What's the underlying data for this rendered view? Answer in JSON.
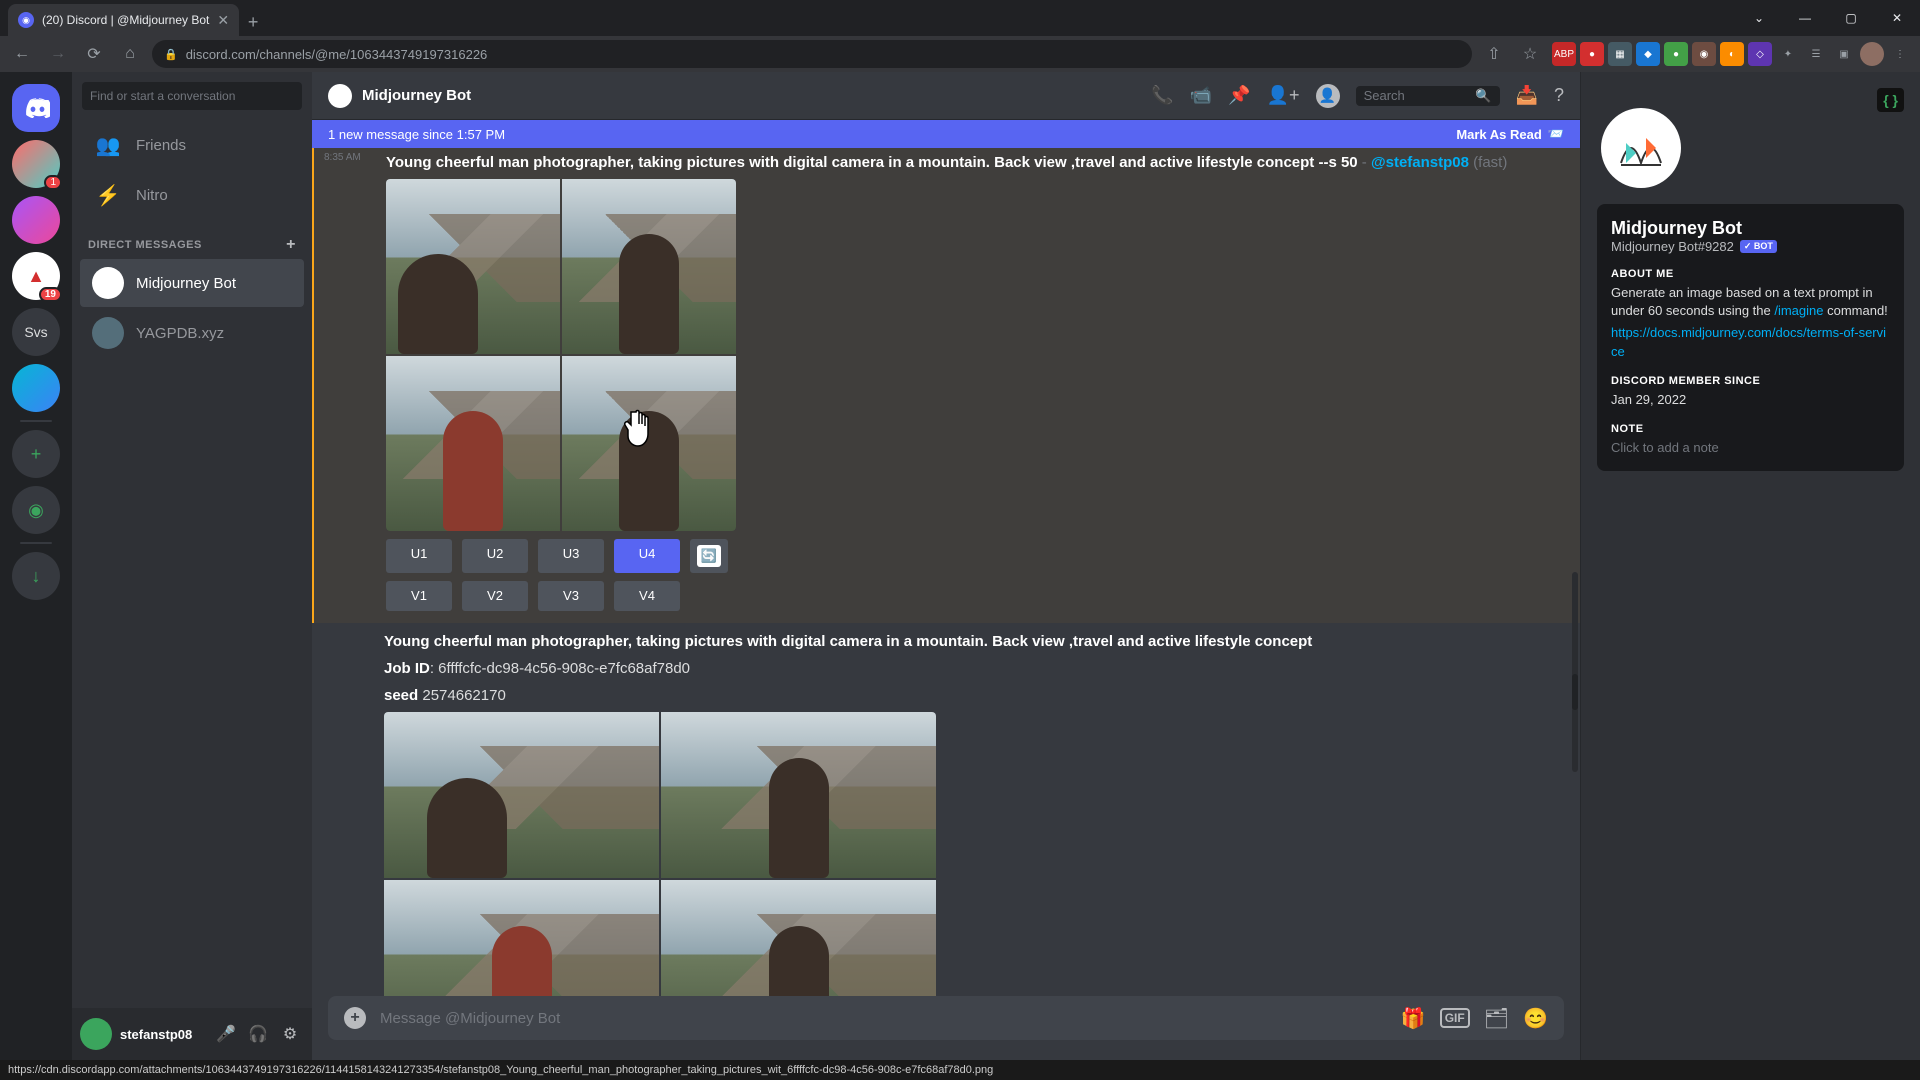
{
  "browser": {
    "tab_title": "(20) Discord | @Midjourney Bot",
    "url": "discord.com/channels/@me/1063443749197316226",
    "win": {
      "min": "—",
      "max": "▢",
      "close": "✕",
      "dropdown": "⌄"
    }
  },
  "discord": {
    "find_placeholder": "Find or start a conversation",
    "friends_label": "Friends",
    "nitro_label": "Nitro",
    "dm_header": "DIRECT MESSAGES",
    "dms": [
      {
        "name": "Midjourney Bot",
        "active": true
      },
      {
        "name": "YAGPDB.xyz",
        "active": false
      }
    ],
    "servers": {
      "home_badge": "1",
      "svs_label": "Svs",
      "unread_19": "19"
    },
    "user_footer": {
      "name": "stefanstp08"
    },
    "header": {
      "title": "Midjourney Bot",
      "search_placeholder": "Search"
    },
    "banner": {
      "text": "1 new message since 1:57 PM",
      "mark": "Mark As Read"
    },
    "message1": {
      "time": "8:35 AM",
      "prompt": "Young cheerful man photographer, taking pictures with digital camera in a mountain. Back view ,travel and active lifestyle concept --s 50",
      "sep": " - ",
      "mention": "@stefanstp08",
      "mode": " (fast)",
      "buttons_u": [
        "U1",
        "U2",
        "U3",
        "U4"
      ],
      "buttons_v": [
        "V1",
        "V2",
        "V3",
        "V4"
      ],
      "reroll": "↻"
    },
    "message2": {
      "prompt": "Young cheerful man photographer, taking pictures with digital camera in a mountain. Back view ,travel and active lifestyle concept",
      "jobid_label": "Job ID",
      "jobid": ": 6ffffcfc-dc98-4c56-908c-e7fc68af78d0",
      "seed_label": "seed",
      "seed": " 2574662170"
    },
    "composer": {
      "placeholder": "Message @Midjourney Bot"
    },
    "profile": {
      "name": "Midjourney Bot",
      "tag": "Midjourney Bot#9282",
      "bot": "✓ BOT",
      "about_h": "ABOUT ME",
      "about_1": "Generate an image based on a text prompt in under 60 seconds using the ",
      "about_cmd": "/imagine",
      "about_2": " command!",
      "link": "https://docs.midjourney.com/docs/terms-of-service",
      "member_h": "DISCORD MEMBER SINCE",
      "member_date": "Jan 29, 2022",
      "note_h": "NOTE",
      "note_placeholder": "Click to add a note",
      "dev_badge": "{ }"
    }
  },
  "status_url": "https://cdn.discordapp.com/attachments/1063443749197316226/1144158143241273354/stefanstp08_Young_cheerful_man_photographer_taking_pictures_wit_6ffffcfc-dc98-4c56-908c-e7fc68af78d0.png"
}
